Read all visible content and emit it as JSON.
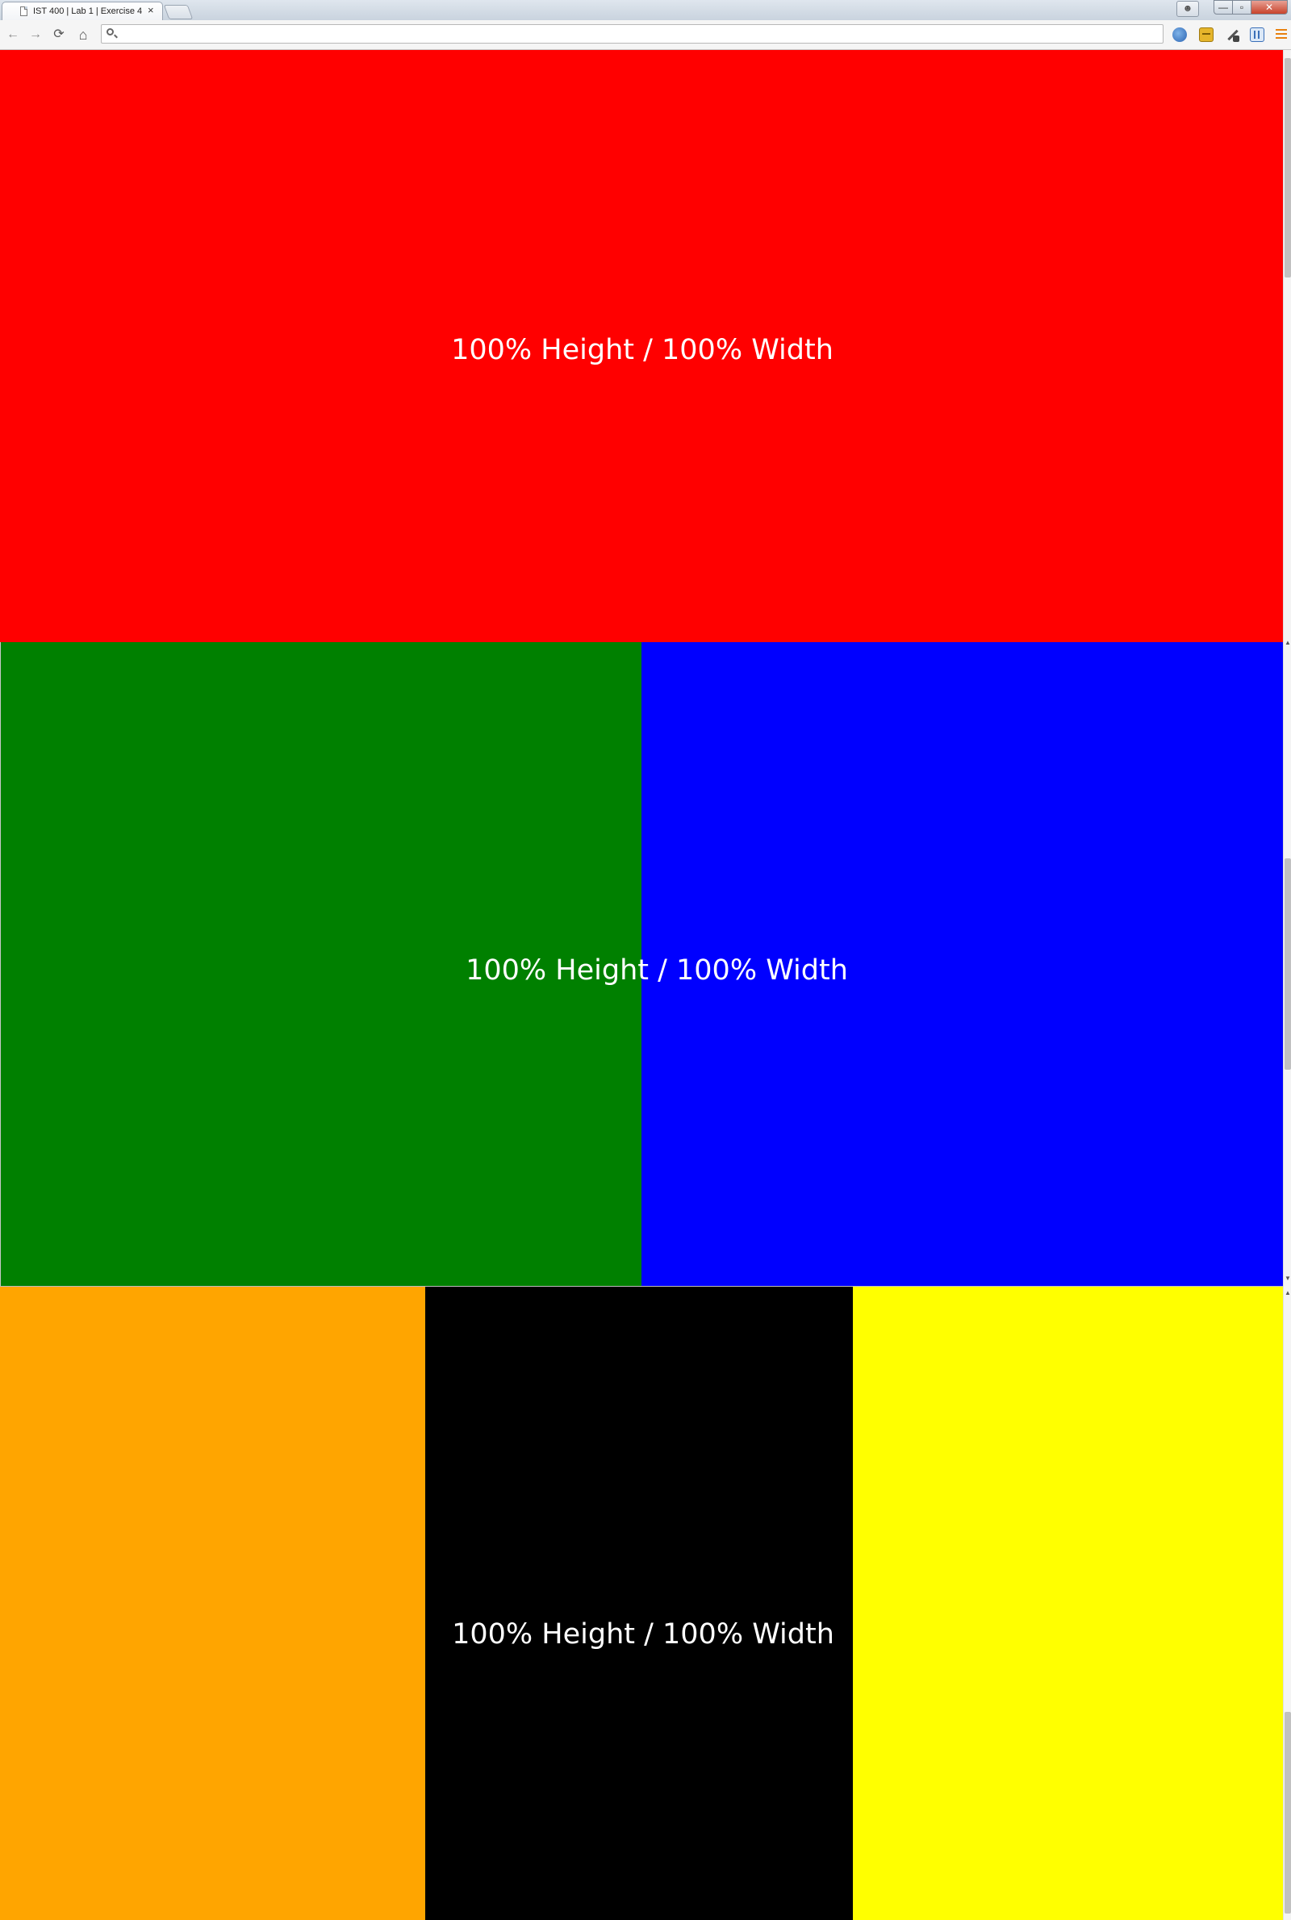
{
  "browser": {
    "tab_title": "IST 400 | Lab 1 | Exercise 4",
    "tab_close": "×",
    "window_controls": {
      "minimize": "—",
      "maximize": "▫",
      "close": "✕"
    },
    "nav": {
      "back": "←",
      "forward": "→",
      "reload": "⟳",
      "home": "⌂"
    },
    "address_value": "",
    "extensions": [
      "globe-icon",
      "card-icon",
      "tools-icon",
      "bars-icon"
    ]
  },
  "page": {
    "sections": [
      {
        "caption": "100% Height / 100% Width",
        "colors": [
          "#ff0000"
        ]
      },
      {
        "caption": "100% Height / 100% Width",
        "colors": [
          "#008000",
          "#0000ff"
        ]
      },
      {
        "caption": "100% Height / 100% Width",
        "colors": [
          "#ffa500",
          "#000000",
          "#ffff00"
        ]
      }
    ]
  },
  "scrollbar": {
    "arrows": [
      "▲",
      "▼"
    ]
  }
}
